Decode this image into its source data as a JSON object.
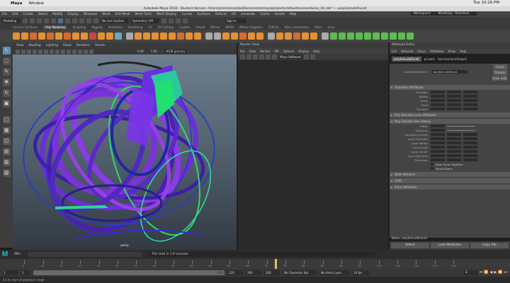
{
  "mac_menubar": {
    "app": "Maya",
    "menu": "Window",
    "clock": "Tue 10:16 PM"
  },
  "window_title": "Autodesk Maya 2018 - Student Version: /Users/jeremarcombe/Documents/maya/projects/default/scenes/Sonic_01.mb* --- polyExtrudeFace4",
  "maya_menu": [
    "File",
    "Edit",
    "Create",
    "Select",
    "Modify",
    "Display",
    "Windows",
    "Mesh",
    "Edit Mesh",
    "Mesh Tools",
    "Mesh Display",
    "Curves",
    "Surfaces",
    "Deform",
    "UV",
    "Generate",
    "Cache",
    "Arnold",
    "Help"
  ],
  "workspace": {
    "label": "Workspace:",
    "value": "Modeling - Standard"
  },
  "status_line": {
    "menu_set": "Modeling",
    "live_surface": "No Live Surface",
    "symmetry": "Symmetry: Off",
    "sign_in": "Sign In"
  },
  "shelf_tabs": [
    "Curves / Surfaces",
    "Poly Modeling",
    "Sculpting",
    "Rigging",
    "Animation",
    "Rendering",
    "FX",
    "FX Caching",
    "Custom",
    "Arnold",
    "Bifrost",
    "MASH",
    "Motion Graphics",
    "TURTLE",
    "XGen_Interactive",
    "XGen",
    "Lava"
  ],
  "shelf_active": "Poly Modeling",
  "shelf_icon_colors": [
    "#e8902f",
    "#e8902f",
    "#d86a2c",
    "#e8902f",
    "#d86a2c",
    "#e8902f",
    "#d86a2c",
    "#e8902f",
    "#e8902f",
    "#c44",
    "#e8902f",
    "#e8902f",
    "#6ab",
    "#aaa",
    "#e8902f",
    "#e8902f",
    "#e8902f",
    "#e8902f",
    "#e8902f",
    "#d86a2c",
    "#e8902f",
    "#e8902f",
    "#aaa",
    "#aaa",
    "#e8902f",
    "#e8902f",
    "#d86a2c",
    "#e8902f",
    "#e8902f",
    "#aaa",
    "#e8902f",
    "#e8902f",
    "#d86a2c",
    "#e8902f",
    "#e8902f",
    "#aaa",
    "#5bbf4f",
    "#5bbf4f",
    "#5bbf4f",
    "#5bbf4f",
    "#5bbf4f",
    "#5bbf4f",
    "#5bbf4f",
    "#5bbf4f",
    "#5bbf4f",
    "#5bbf4f"
  ],
  "viewport": {
    "menu": [
      "View",
      "Shading",
      "Lighting",
      "Show",
      "Renderer",
      "Panels"
    ],
    "values": [
      "0.00",
      "1.00",
      "sRGB gamma"
    ],
    "camera_label": "persp"
  },
  "render_view": {
    "title": "Render View",
    "menu": [
      "File",
      "View",
      "Render",
      "IPR",
      "Options",
      "Display",
      "Help"
    ],
    "renderer": "Maya Software"
  },
  "attribute_editor": {
    "title": "Attribute Editor",
    "menu": [
      "List",
      "Selected",
      "Focus",
      "Attributes",
      "Show",
      "Help"
    ],
    "tabs": [
      "polyExtrudeFace4",
      "pCube1",
      "SonicSurfaceShape1"
    ],
    "node_label": "polyExtrudeFace:",
    "node_value": "polyExtrudeFace4",
    "side_buttons": [
      "Focus",
      "Presets",
      "Show",
      "Hide"
    ],
    "sections": [
      {
        "name": "Transform Attributes",
        "open": true,
        "rows": [
          "Translate",
          "Rotate",
          "Scale",
          "Pivot",
          "Random"
        ]
      },
      {
        "name": "Poly Extrude Curve Attributes",
        "open": false,
        "rows": []
      },
      {
        "name": "Poly Extrude Face History",
        "open": true,
        "rows": [
          "Offset",
          "Divisions",
          "Smoothing Angle",
          "Local Translate",
          "Local Rotate",
          "Local Scale",
          "Local Center",
          "Local Direction",
          "Thickness",
          "Keep Faces Together"
        ]
      },
      {
        "name": "Node Behavior",
        "open": false,
        "rows": []
      },
      {
        "name": "UUID",
        "open": false,
        "rows": []
      },
      {
        "name": "Extra Attributes",
        "open": false,
        "rows": []
      }
    ],
    "keep_faces_together": "Keep Faces Together",
    "world_space": "World Space",
    "notes": "Notes: polyExtrudeFace4",
    "bottom_buttons": [
      "Select",
      "Load Attributes",
      "Copy Tab"
    ]
  },
  "command_line": {
    "logo": "M",
    "mode": "MEL",
    "feedback": "File read in 1.9 seconds."
  },
  "timeline": {
    "ticks": [
      "5",
      "10",
      "15",
      "20",
      "25",
      "30",
      "35",
      "40",
      "45",
      "50",
      "55",
      "60",
      "65",
      "70",
      "75",
      "80",
      "85",
      "90",
      "95",
      "100",
      "105",
      "110",
      "115",
      "120"
    ],
    "current_frame": "1"
  },
  "range": {
    "start": "1",
    "inner_start": "1",
    "inner_end": "120",
    "end": "120",
    "scene_end": "200",
    "end2": "200",
    "character_set": "No Character Set",
    "anim_layer": "No Anim Layer",
    "fps": "24 fps"
  },
  "help_line": "Go to start of playback range"
}
